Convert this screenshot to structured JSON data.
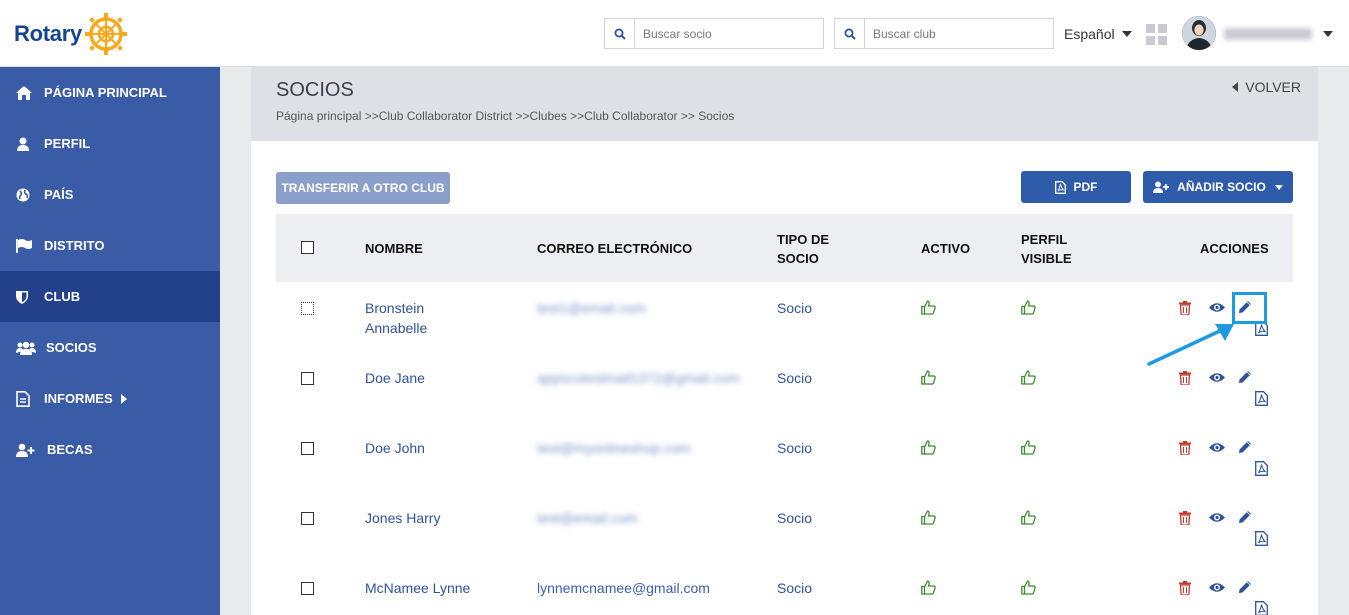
{
  "header": {
    "logo_text": "Rotary",
    "search_member_placeholder": "Buscar socio",
    "search_club_placeholder": "Buscar club",
    "language": "Español"
  },
  "sidebar": {
    "items": [
      {
        "label": "PÁGINA PRINCIPAL",
        "icon": "home-icon"
      },
      {
        "label": "PERFIL",
        "icon": "user-icon"
      },
      {
        "label": "PAÍS",
        "icon": "globe-icon"
      },
      {
        "label": "DISTRITO",
        "icon": "flag-icon"
      },
      {
        "label": "CLUB",
        "icon": "shield-icon",
        "active": true
      },
      {
        "label": "SOCIOS",
        "icon": "users-icon"
      },
      {
        "label": "INFORMES",
        "icon": "document-icon"
      },
      {
        "label": "BECAS",
        "icon": "user-plus-icon"
      }
    ]
  },
  "page": {
    "title": "SOCIOS",
    "back_label": "VOLVER",
    "breadcrumb": "Página principal >>Club Collaborator District >>Clubes >>Club Collaborator >> Socios"
  },
  "toolbar": {
    "transfer_label": "TRANSFERIR A OTRO CLUB",
    "pdf_label": "PDF",
    "add_label": "AÑADIR SOCIO"
  },
  "table": {
    "headers": {
      "name": "NOMBRE",
      "email": "CORREO ELECTRÓNICO",
      "type_line1": "TIPO DE",
      "type_line2": "SOCIO",
      "active": "ACTIVO",
      "visible_line1": "PERFIL",
      "visible_line2": "VISIBLE",
      "actions": "ACCIONES"
    },
    "rows": [
      {
        "name_line1": "Bronstein",
        "name_line2": "Annabelle",
        "email": "test1@email.com",
        "email_blurred": true,
        "type": "Socio"
      },
      {
        "name_line1": "Doe Jane",
        "name_line2": "",
        "email": "appscotestmail1372@gmail.com",
        "email_blurred": true,
        "type": "Socio"
      },
      {
        "name_line1": "Doe John",
        "name_line2": "",
        "email": "test@myonlineshop.com",
        "email_blurred": true,
        "type": "Socio"
      },
      {
        "name_line1": "Jones Harry",
        "name_line2": "",
        "email": "test@email.com",
        "email_blurred": true,
        "type": "Socio"
      },
      {
        "name_line1": "McNamee Lynne",
        "name_line2": "",
        "email": "lynnemcnamee@gmail.com",
        "email_blurred": false,
        "type": "Socio"
      }
    ]
  },
  "colors": {
    "sidebar": "#3a5ba5",
    "sidebar_active": "#23418a",
    "primary_button": "#2f5bab",
    "link": "#2f5398",
    "thumb_green": "#3c8a2e",
    "delete_red": "#c0392b",
    "highlight": "#1d9ae0"
  }
}
